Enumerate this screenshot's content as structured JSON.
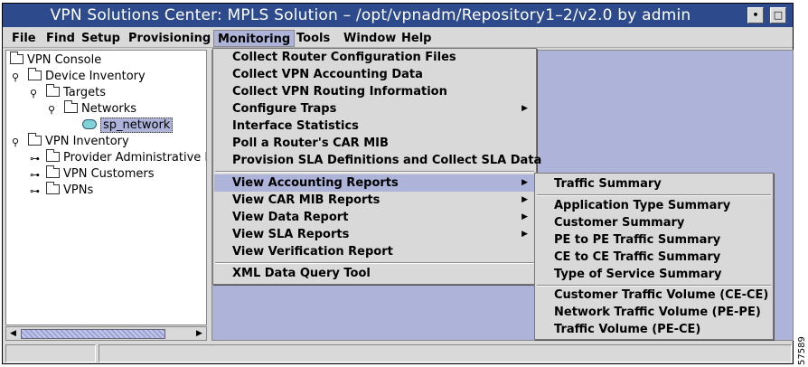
{
  "window": {
    "title": "VPN Solutions Center: MPLS Solution – /opt/vpnadm/Repository1–2/v2.0 by admin",
    "minimize_glyph": "•",
    "maximize_glyph": "□"
  },
  "menubar": {
    "items": [
      {
        "label": "File"
      },
      {
        "label": "Find"
      },
      {
        "label": "Setup"
      },
      {
        "label": "Provisioning"
      },
      {
        "label": "Monitoring"
      },
      {
        "label": "Tools"
      },
      {
        "label": "Window"
      },
      {
        "label": "Help"
      }
    ]
  },
  "tree": {
    "nodes": [
      {
        "label": "VPN Console"
      },
      {
        "label": "Device Inventory"
      },
      {
        "label": "Targets"
      },
      {
        "label": "Networks"
      },
      {
        "label": "sp_network"
      },
      {
        "label": "VPN Inventory"
      },
      {
        "label": "Provider Administrative D"
      },
      {
        "label": "VPN Customers"
      },
      {
        "label": "VPNs"
      }
    ]
  },
  "monitoring_menu": {
    "items": [
      {
        "label": "Collect Router Configuration Files"
      },
      {
        "label": "Collect VPN Accounting Data"
      },
      {
        "label": "Collect VPN Routing Information"
      },
      {
        "label": "Configure Traps"
      },
      {
        "label": "Interface Statistics"
      },
      {
        "label": "Poll a Router's CAR MIB"
      },
      {
        "label": "Provision SLA Definitions and Collect SLA Data"
      },
      {
        "label": "View Accounting Reports"
      },
      {
        "label": "View CAR MIB Reports"
      },
      {
        "label": "View Data Report"
      },
      {
        "label": "View SLA Reports"
      },
      {
        "label": "View Verification Report"
      },
      {
        "label": "XML Data Query Tool"
      }
    ]
  },
  "accounting_submenu": {
    "items": [
      {
        "label": "Traffic Summary"
      },
      {
        "label": "Application Type Summary"
      },
      {
        "label": "Customer Summary"
      },
      {
        "label": "PE to PE Traffic Summary"
      },
      {
        "label": "CE to CE Traffic Summary"
      },
      {
        "label": "Type of Service Summary"
      },
      {
        "label": "Customer Traffic Volume (CE-CE)"
      },
      {
        "label": "Network Traffic Volume (PE-PE)"
      },
      {
        "label": "Traffic Volume (PE-CE)"
      }
    ]
  },
  "figure_code": "57589",
  "colors": {
    "titlebar": "#2c4a8c",
    "highlight": "#aeb3d9",
    "chrome": "#d9d9d9"
  }
}
